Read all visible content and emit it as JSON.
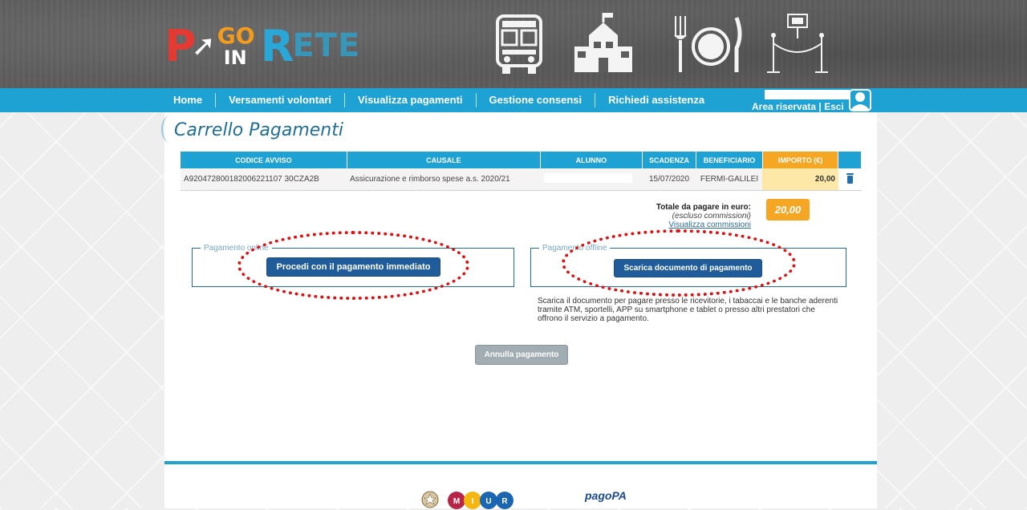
{
  "brand": {
    "logo_text_p": "P",
    "logo_text_go": "GO",
    "logo_text_in": "IN",
    "logo_text_r": "R",
    "logo_text_ete": "ETE"
  },
  "nav": {
    "items": [
      "Home",
      "Versamenti volontari",
      "Visualizza pagamenti",
      "Gestione consensi",
      "Richiedi assistenza"
    ],
    "area": "Area riservata",
    "sep": " | ",
    "esci": "Esci"
  },
  "page": {
    "title": "Carrello Pagamenti"
  },
  "table": {
    "headers": [
      "CODICE AVVISO",
      "CAUSALE",
      "ALUNNO",
      "SCADENZA",
      "BENEFICIARIO",
      "IMPORTO (€)"
    ],
    "row": {
      "codice": "A920472800182006221107 30CZA2B",
      "causale": "Assicurazione e rimborso spese a.s. 2020/21",
      "alunno": "",
      "scadenza": "15/07/2020",
      "beneficiario": "FERMI-GALILEI",
      "importo": "20,00"
    }
  },
  "totals": {
    "label": "Totale da pagare in euro:",
    "note": "(escluso commissioni)",
    "link": "Visualizza commissioni",
    "value": "20,00"
  },
  "online": {
    "legend": "Pagamento online",
    "button": "Procedi con il pagamento immediato"
  },
  "offline": {
    "legend": "Pagamento offline",
    "button": "Scarica documento di pagamento",
    "desc": "Scarica il documento per pagare presso le ricevitorie, i tabaccai e le banche aderenti tramite ATM, sportelli, APP su smartphone e tablet o presso altri prestatori che offrono il servizio a pagamento."
  },
  "cancel": {
    "button": "Annulla pagamento"
  },
  "footer": {
    "pagopa": "pagoPA",
    "miur": "MIUR"
  },
  "colors": {
    "accent": "#1ea2d3",
    "orange": "#f5a623",
    "button": "#1f5c99",
    "annotation": "#e01010"
  }
}
